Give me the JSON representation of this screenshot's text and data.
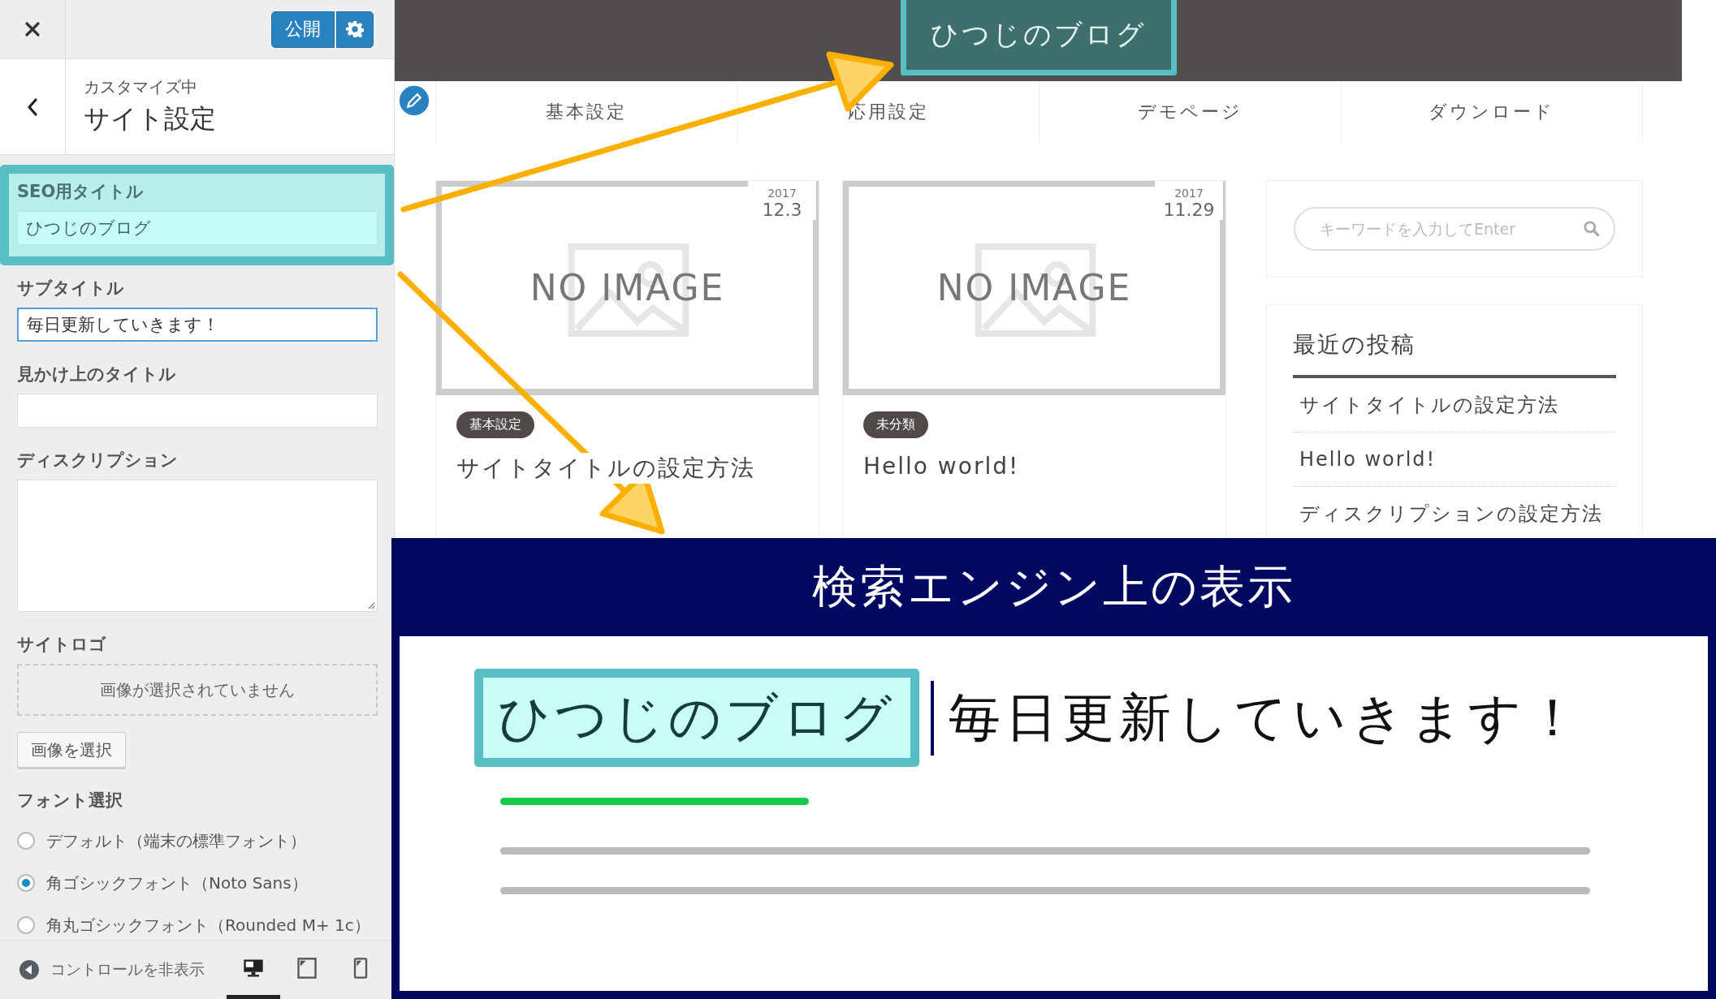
{
  "panel": {
    "publish_button": "公開",
    "breadcrumb": "カスタマイズ中",
    "section_title": "サイト設定",
    "controls": [
      {
        "kind": "text",
        "label": "SEO用タイトル",
        "value": "ひつじのブログ",
        "highlighted": true,
        "focused": false
      },
      {
        "kind": "text",
        "label": "サブタイトル",
        "value": "毎日更新していきます！",
        "highlighted": false,
        "focused": true
      },
      {
        "kind": "text",
        "label": "見かけ上のタイトル",
        "highlighted": false,
        "focused": false
      },
      {
        "kind": "textarea",
        "label": "ディスクリプション",
        "highlighted": false,
        "focused": false
      },
      {
        "kind": "image",
        "label": "サイトロゴ",
        "empty_text": "画像が選択されていません",
        "button": "画像を選択",
        "highlighted": false
      },
      {
        "kind": "radio",
        "label": "フォント選択",
        "highlighted": false,
        "options": [
          {
            "label": "デフォルト（端末の標準フォント）",
            "selected": false
          },
          {
            "label": "角ゴシックフォント（Noto Sans）",
            "selected": true
          },
          {
            "label": "角丸ゴシックフォント（Rounded M+ 1c）",
            "selected": false
          }
        ]
      }
    ],
    "footer": {
      "hide_controls": "コントロールを非表示",
      "devices": [
        {
          "kind": "desktop",
          "selected": true
        },
        {
          "kind": "tablet",
          "selected": false
        },
        {
          "kind": "mobile",
          "selected": false
        }
      ]
    }
  },
  "preview": {
    "site_title": "ひつじのブログ",
    "nav": [
      "基本設定",
      "応用設定",
      "デモページ",
      "ダウンロード"
    ],
    "posts": [
      {
        "year": "2017",
        "date": "12.3",
        "no_image": "NO IMAGE",
        "category": "基本設定",
        "title": "サイトタイトルの設定方法"
      },
      {
        "year": "2017",
        "date": "11.29",
        "no_image": "NO IMAGE",
        "category": "未分類",
        "title": "Hello world!"
      }
    ],
    "sidebar": {
      "search_placeholder": "キーワードを入力してEnter",
      "recent_title": "最近の投稿",
      "recent": [
        "サイトタイトルの設定方法",
        "Hello world!",
        "ディスクリプションの設定方法"
      ]
    }
  },
  "search_preview": {
    "heading": "検索エンジン上の表示",
    "title": "ひつじのブログ",
    "subtitle": "毎日更新していきます！"
  }
}
